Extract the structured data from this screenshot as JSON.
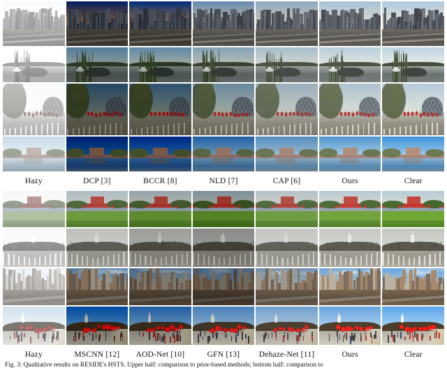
{
  "figure": {
    "caption": "Fig. 3: Qualitative results on RESIDE's HSTS. Upper half: comparison to prior-based methods; bottom half: comparison to",
    "upper_half": {
      "label_row": [
        "Hazy",
        "DCP [3]",
        "BCCR [8]",
        "NLD [7]",
        "CAP [6]",
        "Ours",
        "Clear"
      ],
      "rows": [
        {
          "scene": "beijing-cbd-skyline",
          "cells": [
            {
              "method": "Hazy",
              "sky_top": "#ccd6de",
              "sky_bottom": "#e3e3de",
              "haze": 0.62,
              "exposure": 1.12,
              "saturation": 0.35
            },
            {
              "method": "DCP [3]",
              "sky_top": "#0c2a6e",
              "sky_bottom": "#e6a45a",
              "haze": 0.0,
              "exposure": 0.78,
              "saturation": 1.45
            },
            {
              "method": "BCCR [8]",
              "sky_top": "#123a82",
              "sky_bottom": "#e9b172",
              "haze": 0.0,
              "exposure": 0.82,
              "saturation": 1.5
            },
            {
              "method": "NLD [7]",
              "sky_top": "#6f98c4",
              "sky_bottom": "#efd7b4",
              "haze": 0.1,
              "exposure": 0.92,
              "saturation": 1.12
            },
            {
              "method": "CAP [6]",
              "sky_top": "#8fb0cd",
              "sky_bottom": "#f0dcbe",
              "haze": 0.14,
              "exposure": 0.95,
              "saturation": 1.0
            },
            {
              "method": "Ours",
              "sky_top": "#9dbcd6",
              "sky_bottom": "#eee0c8",
              "haze": 0.12,
              "exposure": 1.0,
              "saturation": 0.95
            },
            {
              "method": "Clear",
              "sky_top": "#a7c3da",
              "sky_bottom": "#f2e4cd",
              "haze": 0.08,
              "exposure": 1.02,
              "saturation": 1.0
            }
          ]
        },
        {
          "scene": "lake-reeds-boat",
          "cells": [
            {
              "method": "Hazy",
              "sky_top": "#d8dcd8",
              "sky_bottom": "#e7e8e3",
              "haze": 0.66,
              "exposure": 1.12,
              "saturation": 0.25
            },
            {
              "method": "DCP [3]",
              "sky_top": "#7aa7c9",
              "sky_bottom": "#c9d6d2",
              "haze": 0.08,
              "exposure": 0.8,
              "saturation": 1.4
            },
            {
              "method": "BCCR [8]",
              "sky_top": "#86aecb",
              "sky_bottom": "#d6ddd4",
              "haze": 0.05,
              "exposure": 0.84,
              "saturation": 1.45
            },
            {
              "method": "NLD [7]",
              "sky_top": "#95b8d0",
              "sky_bottom": "#dde2d8",
              "haze": 0.12,
              "exposure": 0.9,
              "saturation": 1.15
            },
            {
              "method": "CAP [6]",
              "sky_top": "#a8c4d6",
              "sky_bottom": "#e1e4dc",
              "haze": 0.2,
              "exposure": 0.96,
              "saturation": 1.0
            },
            {
              "method": "Ours",
              "sky_top": "#b0c9da",
              "sky_bottom": "#e3e6de",
              "haze": 0.16,
              "exposure": 1.0,
              "saturation": 1.0
            },
            {
              "method": "Clear",
              "sky_top": "#b6cddd",
              "sky_bottom": "#e6e8e0",
              "haze": 0.12,
              "exposure": 1.02,
              "saturation": 1.05
            }
          ]
        },
        {
          "scene": "birds-nest-stadium-street",
          "cells": [
            {
              "method": "Hazy",
              "sky_top": "#dbdfdb",
              "sky_bottom": "#e6e7e2",
              "haze": 0.6,
              "exposure": 1.1,
              "saturation": 0.3
            },
            {
              "method": "DCP [3]",
              "sky_top": "#4a6f8e",
              "sky_bottom": "#9aa79d",
              "haze": 0.0,
              "exposure": 0.72,
              "saturation": 1.5
            },
            {
              "method": "BCCR [8]",
              "sky_top": "#55799a",
              "sky_bottom": "#a3b0a4",
              "haze": 0.0,
              "exposure": 0.76,
              "saturation": 1.5
            },
            {
              "method": "NLD [7]",
              "sky_top": "#7d9fb8",
              "sky_bottom": "#c3ccbf",
              "haze": 0.08,
              "exposure": 0.88,
              "saturation": 1.2
            },
            {
              "method": "CAP [6]",
              "sky_top": "#9ab4c7",
              "sky_bottom": "#d3d8cd",
              "haze": 0.18,
              "exposure": 0.95,
              "saturation": 1.0
            },
            {
              "method": "Ours",
              "sky_top": "#a4bccd",
              "sky_bottom": "#d8dcd2",
              "haze": 0.14,
              "exposure": 1.0,
              "saturation": 1.0
            },
            {
              "method": "Clear",
              "sky_top": "#aec3d3",
              "sky_bottom": "#dce0d6",
              "haze": 0.1,
              "exposure": 1.02,
              "saturation": 1.05
            }
          ]
        },
        {
          "scene": "forbidden-city-corner-tower-moat",
          "cells": [
            {
              "method": "Hazy",
              "sky_top": "#8fbcdd",
              "sky_bottom": "#cfe0ea",
              "haze": 0.4,
              "exposure": 1.08,
              "saturation": 0.6
            },
            {
              "method": "DCP [3]",
              "sky_top": "#072f86",
              "sky_bottom": "#3c7ab5",
              "haze": 0.0,
              "exposure": 0.72,
              "saturation": 1.6
            },
            {
              "method": "BCCR [8]",
              "sky_top": "#0b3a96",
              "sky_bottom": "#4a86bd",
              "haze": 0.0,
              "exposure": 0.76,
              "saturation": 1.6
            },
            {
              "method": "NLD [7]",
              "sky_top": "#2f6fb4",
              "sky_bottom": "#8cb8d6",
              "haze": 0.04,
              "exposure": 0.88,
              "saturation": 1.25
            },
            {
              "method": "CAP [6]",
              "sky_top": "#4f8cc4",
              "sky_bottom": "#a3c7de",
              "haze": 0.1,
              "exposure": 0.96,
              "saturation": 1.05
            },
            {
              "method": "Ours",
              "sky_top": "#4d8ec8",
              "sky_bottom": "#a8cbe2",
              "haze": 0.06,
              "exposure": 1.0,
              "saturation": 1.1
            },
            {
              "method": "Clear",
              "sky_top": "#3f88c8",
              "sky_bottom": "#a0c7e2",
              "haze": 0.04,
              "exposure": 1.02,
              "saturation": 1.15
            }
          ]
        }
      ]
    },
    "lower_half": {
      "label_row": [
        "Hazy",
        "MSCNN [12]",
        "AOD-Net [10]",
        "GFN [13]",
        "Dehaze-Net [11]",
        "Ours",
        "Clear"
      ],
      "rows": [
        {
          "scene": "tiananmen-gate-green-lawn",
          "cells": [
            {
              "method": "Hazy",
              "sky_top": "#d9dcd8",
              "sky_bottom": "#e6e6e0",
              "haze": 0.5,
              "exposure": 1.1,
              "saturation": 0.5
            },
            {
              "method": "MSCNN [12]",
              "sky_top": "#b8c6cd",
              "sky_bottom": "#d6d9d2",
              "haze": 0.2,
              "exposure": 0.95,
              "saturation": 1.3
            },
            {
              "method": "AOD-Net [10]",
              "sky_top": "#aab8c0",
              "sky_bottom": "#cdd2ca",
              "haze": 0.14,
              "exposure": 0.9,
              "saturation": 1.35
            },
            {
              "method": "GFN [13]",
              "sky_top": "#9fb0ba",
              "sky_bottom": "#c6ccc4",
              "haze": 0.1,
              "exposure": 0.86,
              "saturation": 1.4
            },
            {
              "method": "Dehaze-Net [11]",
              "sky_top": "#bcc8ce",
              "sky_bottom": "#d9dbd4",
              "haze": 0.22,
              "exposure": 0.96,
              "saturation": 1.25
            },
            {
              "method": "Ours",
              "sky_top": "#b4c3cb",
              "sky_bottom": "#d4d8d0",
              "haze": 0.16,
              "exposure": 1.0,
              "saturation": 1.3
            },
            {
              "method": "Clear",
              "sky_top": "#b0c2cc",
              "sky_bottom": "#d2d7cf",
              "haze": 0.12,
              "exposure": 1.02,
              "saturation": 1.35
            }
          ]
        },
        {
          "scene": "beihai-white-pagoda-bare-trees",
          "cells": [
            {
              "method": "Hazy",
              "sky_top": "#dcddd8",
              "sky_bottom": "#e6e6e1",
              "haze": 0.55,
              "exposure": 1.1,
              "saturation": 0.3
            },
            {
              "method": "MSCNN [12]",
              "sky_top": "#c4c6c0",
              "sky_bottom": "#d6d6d0",
              "haze": 0.3,
              "exposure": 0.95,
              "saturation": 1.0
            },
            {
              "method": "AOD-Net [10]",
              "sky_top": "#b4b6b0",
              "sky_bottom": "#c9c9c3",
              "haze": 0.22,
              "exposure": 0.88,
              "saturation": 1.1
            },
            {
              "method": "GFN [13]",
              "sky_top": "#a8aba6",
              "sky_bottom": "#c0c1bb",
              "haze": 0.18,
              "exposure": 0.84,
              "saturation": 1.15
            },
            {
              "method": "Dehaze-Net [11]",
              "sky_top": "#c8cac4",
              "sky_bottom": "#d9d9d3",
              "haze": 0.32,
              "exposure": 0.96,
              "saturation": 0.95
            },
            {
              "method": "Ours",
              "sky_top": "#bcbeb8",
              "sky_bottom": "#d0d0ca",
              "haze": 0.24,
              "exposure": 1.0,
              "saturation": 1.05
            },
            {
              "method": "Clear",
              "sky_top": "#b8bab4",
              "sky_bottom": "#cdcdc7",
              "haze": 0.2,
              "exposure": 1.02,
              "saturation": 1.1
            }
          ]
        },
        {
          "scene": "residential-highrise-cloudy-sky",
          "cells": [
            {
              "method": "Hazy",
              "sky_top": "#c9d6e0",
              "sky_bottom": "#e2e6e6",
              "haze": 0.5,
              "exposure": 1.08,
              "saturation": 0.5
            },
            {
              "method": "MSCNN [12]",
              "sky_top": "#5e8fbd",
              "sky_bottom": "#b9c8cf",
              "haze": 0.05,
              "exposure": 0.88,
              "saturation": 1.4
            },
            {
              "method": "AOD-Net [10]",
              "sky_top": "#6a93bb",
              "sky_bottom": "#b5c2c6",
              "haze": 0.04,
              "exposure": 0.78,
              "saturation": 1.45
            },
            {
              "method": "GFN [13]",
              "sky_top": "#6e96bf",
              "sky_bottom": "#b3c0c6",
              "haze": 0.02,
              "exposure": 0.72,
              "saturation": 1.5
            },
            {
              "method": "Dehaze-Net [11]",
              "sky_top": "#7ba0c4",
              "sky_bottom": "#c2ccce",
              "haze": 0.1,
              "exposure": 0.9,
              "saturation": 1.35
            },
            {
              "method": "Ours",
              "sky_top": "#74a0c6",
              "sky_bottom": "#bcc8cc",
              "haze": 0.06,
              "exposure": 1.0,
              "saturation": 1.4
            },
            {
              "method": "Clear",
              "sky_top": "#6f9dc6",
              "sky_bottom": "#bac6cb",
              "haze": 0.04,
              "exposure": 1.02,
              "saturation": 1.45
            }
          ]
        },
        {
          "scene": "beihai-pagoda-red-lanterns-crowd",
          "cells": [
            {
              "method": "Hazy",
              "sky_top": "#a6c4dd",
              "sky_bottom": "#d6e3ea",
              "haze": 0.42,
              "exposure": 1.08,
              "saturation": 0.65
            },
            {
              "method": "MSCNN [12]",
              "sky_top": "#1c62b4",
              "sky_bottom": "#7fb0d8",
              "haze": 0.0,
              "exposure": 0.8,
              "saturation": 1.5
            },
            {
              "method": "AOD-Net [10]",
              "sky_top": "#3a74b8",
              "sky_bottom": "#93bcdc",
              "haze": 0.02,
              "exposure": 0.84,
              "saturation": 1.4
            },
            {
              "method": "GFN [13]",
              "sky_top": "#5a8fc8",
              "sky_bottom": "#a8cbe4",
              "haze": 0.06,
              "exposure": 0.9,
              "saturation": 1.3
            },
            {
              "method": "Dehaze-Net [11]",
              "sky_top": "#76a4d2",
              "sky_bottom": "#bad5e8",
              "haze": 0.12,
              "exposure": 0.95,
              "saturation": 1.2
            },
            {
              "method": "Ours",
              "sky_top": "#6a9ccf",
              "sky_bottom": "#b3d0e6",
              "haze": 0.08,
              "exposure": 1.0,
              "saturation": 1.3
            },
            {
              "method": "Clear",
              "sky_top": "#639ad0",
              "sky_bottom": "#aecee6",
              "haze": 0.06,
              "exposure": 1.02,
              "saturation": 1.35
            }
          ]
        }
      ]
    }
  }
}
